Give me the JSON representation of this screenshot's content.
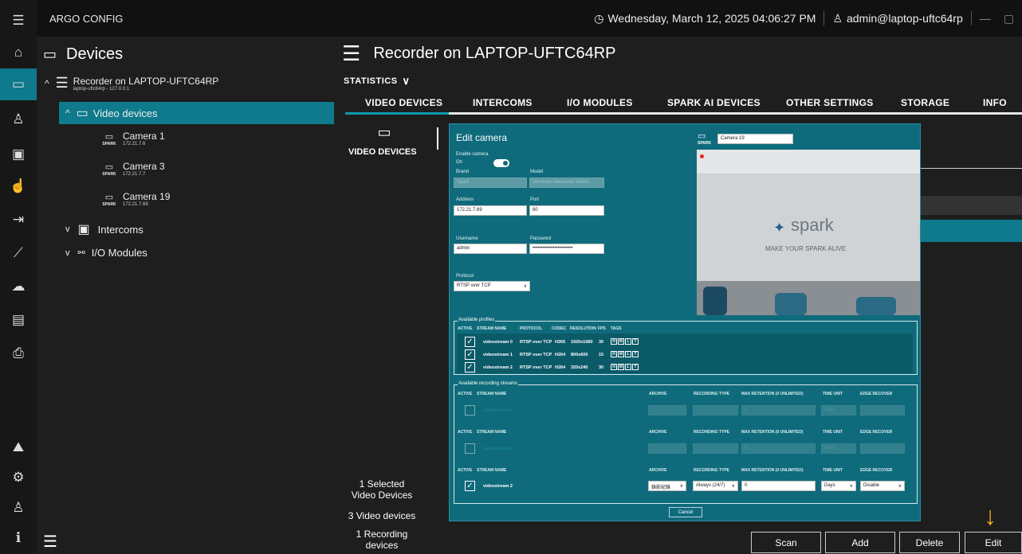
{
  "app": {
    "title": "ARGO CONFIG"
  },
  "topbar": {
    "datetime": "Wednesday, March 12, 2025 04:06:27 PM",
    "user": "admin@laptop-uftc64rp"
  },
  "left_panel": {
    "title": "Devices",
    "recorder": {
      "name": "Recorder on LAPTOP-UFTC64RP",
      "subtitle": "laptop-uftc64rp - 127.0.0.1"
    },
    "video_devices_label": "Video devices",
    "cameras": [
      {
        "name": "Camera 1",
        "brand": "SPARK",
        "ip": "172.21.7.6"
      },
      {
        "name": "Camera 3",
        "brand": "SPARK",
        "ip": "172.21.7.7"
      },
      {
        "name": "Camera 19",
        "brand": "SPARK",
        "ip": "172.21.7.69"
      }
    ],
    "intercoms_label": "Intercoms",
    "io_label": "I/O Modules"
  },
  "main": {
    "title": "Recorder on LAPTOP-UFTC64RP",
    "statistics_label": "STATISTICS",
    "tabs": [
      "VIDEO DEVICES",
      "INTERCOMS",
      "I/O MODULES",
      "SPARK AI DEVICES",
      "OTHER SETTINGS",
      "STORAGE",
      "INFO"
    ],
    "side_label": "VIDEO DEVICES",
    "selected_count": "1 Selected",
    "selected_sub": "Video Devices",
    "video_devices_count": "3 Video devices",
    "recording_count": "1 Recording",
    "recording_sub": "devices"
  },
  "dialog": {
    "title": "Edit camera",
    "enable_camera_label": "Enable camera",
    "enable_on": "On",
    "brand_label": "Brand",
    "brand_value": "Spark",
    "model_label": "Model",
    "model_value": "Omnieye Advanced Series",
    "address_label": "Address",
    "address_value": "172.21.7.69",
    "port_label": "Port",
    "port_value": "80",
    "username_label": "Username",
    "username_value": "admin",
    "password_label": "Password",
    "password_value": "••••••••••••••••••••••••",
    "protocol_label": "Protocol",
    "protocol_value": "RTSP over TCP",
    "camera_name": "Camera 19",
    "preview_brand": "spark",
    "preview_slogan": "MAKE YOUR SPARK ALIVE",
    "profiles_title": "Available profiles",
    "profiles_headers": [
      "ACTIVE",
      "STREAM NAME",
      "PROTOCOL",
      "CODEC",
      "RESOLUTION",
      "FPS",
      "TAGS"
    ],
    "profiles": [
      {
        "stream": "videostream 0",
        "protocol": "RTSP over TCP",
        "codec": "H265",
        "resolution": "1920x1080",
        "fps": "30"
      },
      {
        "stream": "videostream 1",
        "protocol": "RTSP over TCP",
        "codec": "H264",
        "resolution": "800x600",
        "fps": "15"
      },
      {
        "stream": "videostream 2",
        "protocol": "RTSP over TCP",
        "codec": "H264",
        "resolution": "320x240",
        "fps": "30"
      }
    ],
    "tags": [
      "H",
      "M",
      "L",
      "T"
    ],
    "rec_title": "Available recording streams",
    "rec_headers": [
      "ACTIVE",
      "STREAM NAME",
      "ARCHIVE",
      "RECORDING TYPE",
      "MAX RETENTION (0 UNLIMITED)",
      "TIME UNIT",
      "EDGE RECOVER"
    ],
    "rec_rows": [
      {
        "stream": "videostream 0",
        "archive": "",
        "type": "",
        "retention": "0",
        "unit": "Days",
        "edge": ""
      },
      {
        "stream": "videostream 1",
        "archive": "",
        "type": "",
        "retention": "0",
        "unit": "Days",
        "edge": ""
      },
      {
        "stream": "videostream 2",
        "archive": "錄影紀錄",
        "type": "Always (24/7)",
        "retention": "0",
        "unit": "Days",
        "edge": "Disable"
      }
    ],
    "cancel_label": "Cancel"
  },
  "buttons": {
    "scan": "Scan",
    "add": "Add",
    "delete": "Delete",
    "edit": "Edit"
  },
  "colors": {
    "accent": "#0e7a8c",
    "dialog": "#0f6b7b",
    "arrow": "#f5a623"
  }
}
